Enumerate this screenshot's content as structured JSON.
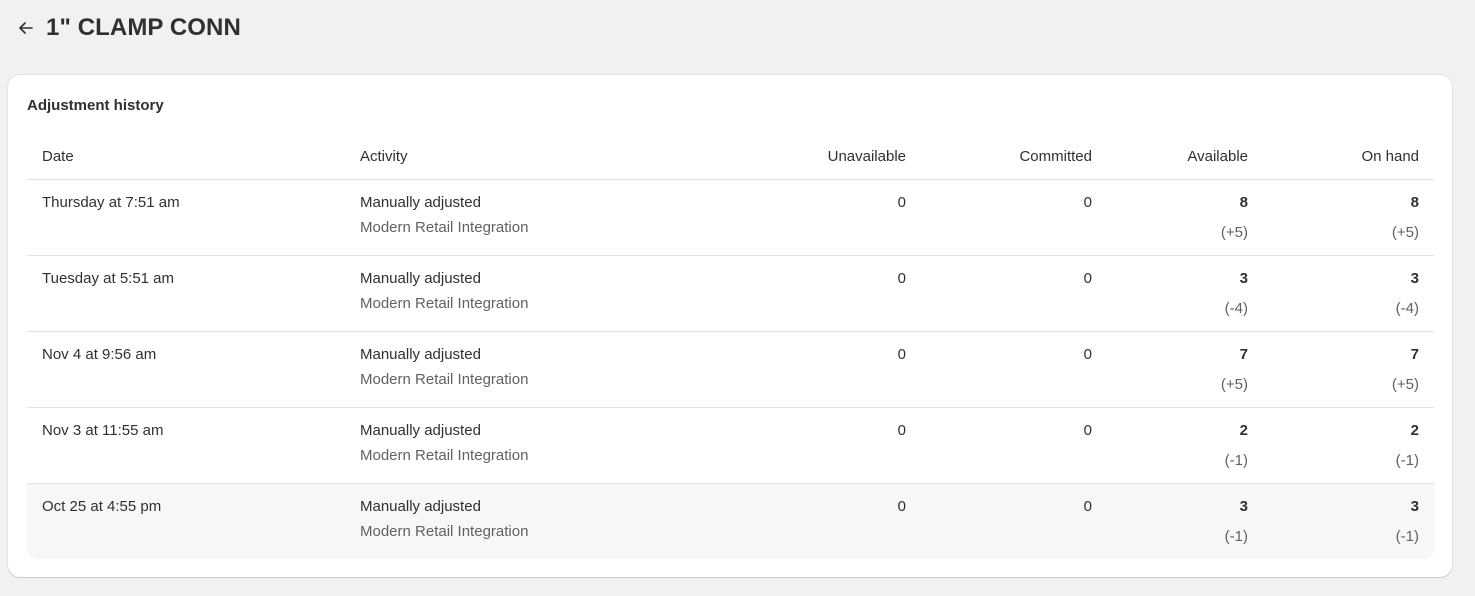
{
  "page": {
    "title": "1\" CLAMP CONN",
    "back_icon": "arrow-left-icon"
  },
  "card": {
    "title": "Adjustment history"
  },
  "table": {
    "columns": {
      "date": "Date",
      "activity": "Activity",
      "unavailable": "Unavailable",
      "committed": "Committed",
      "available": "Available",
      "on_hand": "On hand"
    },
    "rows": [
      {
        "date": "Thursday at 7:51 am",
        "activity": "Manually adjusted",
        "source": "Modern Retail Integration",
        "unavailable": "0",
        "committed": "0",
        "available": "8",
        "available_delta": "(+5)",
        "on_hand": "8",
        "on_hand_delta": "(+5)"
      },
      {
        "date": "Tuesday at 5:51 am",
        "activity": "Manually adjusted",
        "source": "Modern Retail Integration",
        "unavailable": "0",
        "committed": "0",
        "available": "3",
        "available_delta": "(-4)",
        "on_hand": "3",
        "on_hand_delta": "(-4)"
      },
      {
        "date": "Nov 4 at 9:56 am",
        "activity": "Manually adjusted",
        "source": "Modern Retail Integration",
        "unavailable": "0",
        "committed": "0",
        "available": "7",
        "available_delta": "(+5)",
        "on_hand": "7",
        "on_hand_delta": "(+5)"
      },
      {
        "date": "Nov 3 at 11:55 am",
        "activity": "Manually adjusted",
        "source": "Modern Retail Integration",
        "unavailable": "0",
        "committed": "0",
        "available": "2",
        "available_delta": "(-1)",
        "on_hand": "2",
        "on_hand_delta": "(-1)"
      },
      {
        "date": "Oct 25 at 4:55 pm",
        "activity": "Manually adjusted",
        "source": "Modern Retail Integration",
        "unavailable": "0",
        "committed": "0",
        "available": "3",
        "available_delta": "(-1)",
        "on_hand": "3",
        "on_hand_delta": "(-1)"
      }
    ]
  },
  "colors": {
    "page_background": "#f1f1f1",
    "card_background": "#ffffff",
    "text_primary": "#303030",
    "text_secondary": "#616161",
    "divider": "#e3e3e3",
    "row_hover": "#f7f7f7"
  }
}
